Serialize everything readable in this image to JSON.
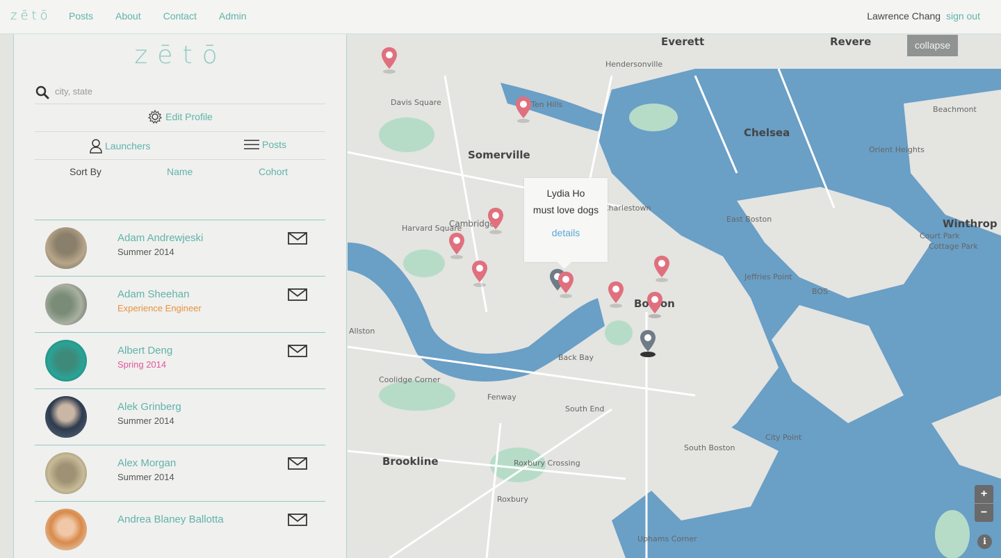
{
  "nav": {
    "brand": "zētō",
    "links": [
      "Posts",
      "About",
      "Contact",
      "Admin"
    ],
    "user_name": "Lawrence Chang",
    "sign_out": "sign out"
  },
  "sidebar": {
    "logo": "zētō",
    "search_placeholder": "city, state",
    "edit_profile": "Edit Profile",
    "tabs": {
      "launchers": "Launchers",
      "posts": "Posts"
    },
    "sort": {
      "label": "Sort By",
      "name": "Name",
      "cohort": "Cohort"
    },
    "people": [
      {
        "name": "Adam Andrewjeski",
        "cohort": "Summer 2014",
        "cohort_color": "#555555",
        "has_mail": true
      },
      {
        "name": "Adam Sheehan",
        "cohort": "Experience Engineer",
        "cohort_color": "#e8913a",
        "has_mail": true
      },
      {
        "name": "Albert Deng",
        "cohort": "Spring 2014",
        "cohort_color": "#e0569b",
        "has_mail": true
      },
      {
        "name": "Alek Grinberg",
        "cohort": "Summer 2014",
        "cohort_color": "#555555",
        "has_mail": false
      },
      {
        "name": "Alex Morgan",
        "cohort": "Summer 2014",
        "cohort_color": "#555555",
        "has_mail": true
      },
      {
        "name": "Andrea Blaney Ballotta",
        "cohort": "",
        "cohort_color": "#555555",
        "has_mail": true
      }
    ]
  },
  "map": {
    "collapse": "collapse",
    "zoom_in": "+",
    "zoom_out": "−",
    "info": "i",
    "popup": {
      "name": "Lydia Ho",
      "desc": "must love dogs",
      "details": "details"
    },
    "places": [
      "Everett",
      "Revere",
      "Chelsea",
      "Somerville",
      "Winthrop",
      "Boston",
      "Brookline",
      "Cambridge",
      "Charlestown",
      "East Boston",
      "Back Bay",
      "South End",
      "South Boston",
      "Fenway",
      "Allston",
      "Jeffries Point",
      "BOS",
      "Davis Square",
      "Harvard Square",
      "Ten Hills",
      "Hendersonville",
      "Beachmont",
      "Orient Heights",
      "Court Park",
      "Cottage Park",
      "Roxbury Crossing",
      "Roxbury",
      "Coolidge Corner",
      "Uphams Corner",
      "City Point"
    ],
    "colors": {
      "water": "#6a9fc6",
      "land": "#e4e4e1",
      "park": "#b6dcc8",
      "pin": "#e0707e",
      "pin_selected": "#6f7b85",
      "accent": "#5fb3a8"
    }
  }
}
